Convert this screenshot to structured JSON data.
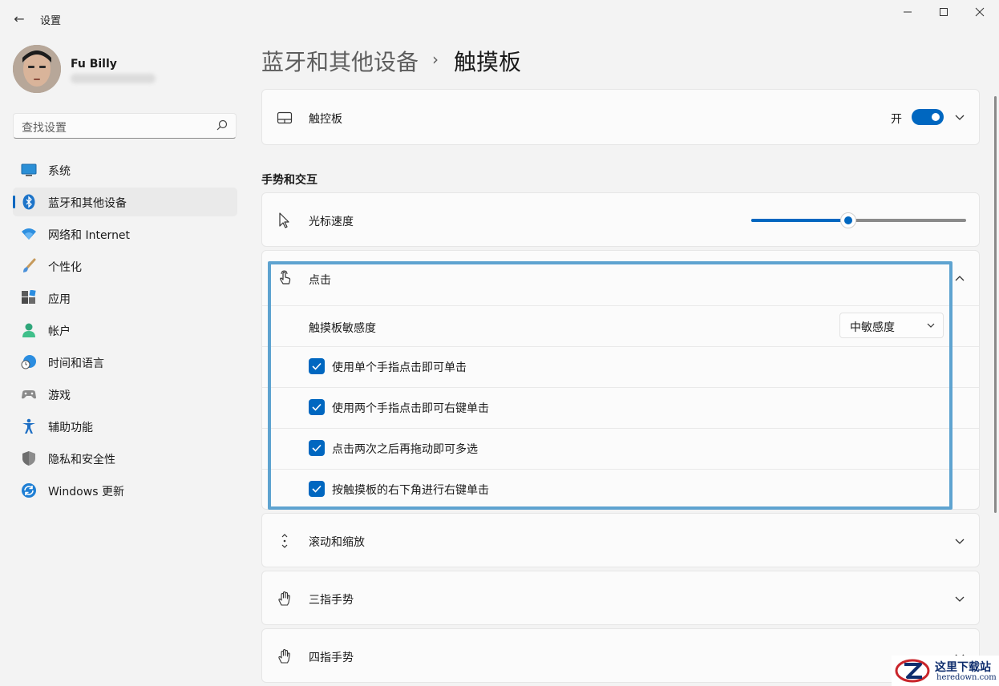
{
  "window": {
    "title": "设置",
    "back_glyph": "←",
    "minimize_glyph": "—",
    "maximize_glyph": "☐",
    "close_glyph": "✕"
  },
  "user": {
    "name": "Fu Billy"
  },
  "search": {
    "placeholder": "查找设置"
  },
  "sidebar": {
    "items": [
      {
        "label": "系统",
        "icon": "monitor-icon"
      },
      {
        "label": "蓝牙和其他设备",
        "icon": "bluetooth-icon",
        "selected": true
      },
      {
        "label": "网络和 Internet",
        "icon": "wifi-icon"
      },
      {
        "label": "个性化",
        "icon": "brush-icon"
      },
      {
        "label": "应用",
        "icon": "apps-icon"
      },
      {
        "label": "帐户",
        "icon": "person-icon"
      },
      {
        "label": "时间和语言",
        "icon": "globe-clock-icon"
      },
      {
        "label": "游戏",
        "icon": "gamepad-icon"
      },
      {
        "label": "辅助功能",
        "icon": "accessibility-icon"
      },
      {
        "label": "隐私和安全性",
        "icon": "shield-icon"
      },
      {
        "label": "Windows 更新",
        "icon": "update-icon"
      }
    ]
  },
  "breadcrumb": {
    "parent": "蓝牙和其他设备",
    "separator": "›",
    "current": "触摸板"
  },
  "touchpad": {
    "label": "触控板",
    "state_label": "开",
    "enabled": true
  },
  "gestures_section": {
    "title": "手势和交互"
  },
  "cursor_speed": {
    "label": "光标速度",
    "value_fraction": 0.45
  },
  "taps": {
    "label": "点击",
    "expanded": true,
    "sensitivity_label": "触摸板敏感度",
    "sensitivity_value": "中敏感度",
    "options": [
      {
        "label": "使用单个手指点击即可单击",
        "checked": true
      },
      {
        "label": "使用两个手指点击即可右键单击",
        "checked": true
      },
      {
        "label": "点击两次之后再拖动即可多选",
        "checked": true
      },
      {
        "label": "按触摸板的右下角进行右键单击",
        "checked": true
      }
    ]
  },
  "scroll_zoom": {
    "label": "滚动和缩放"
  },
  "three_finger": {
    "label": "三指手势"
  },
  "four_finger": {
    "label": "四指手势"
  },
  "watermark": {
    "text": "这里下载站",
    "url": "heredown.com"
  },
  "colors": {
    "accent": "#0067c0",
    "highlight_border": "#5ea3d0"
  }
}
